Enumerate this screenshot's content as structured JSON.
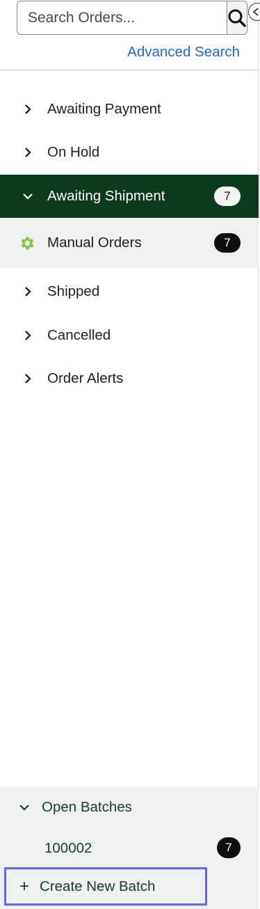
{
  "search": {
    "placeholder": "Search Orders...",
    "advanced_label": "Advanced Search"
  },
  "nav": {
    "items": [
      {
        "label": "Awaiting Payment"
      },
      {
        "label": "On Hold"
      },
      {
        "label": "Awaiting Shipment",
        "count": "7",
        "expanded": true
      },
      {
        "label": "Manual Orders",
        "count": "7"
      },
      {
        "label": "Shipped"
      },
      {
        "label": "Cancelled"
      },
      {
        "label": "Order Alerts"
      }
    ]
  },
  "batches": {
    "header_label": "Open Batches",
    "items": [
      {
        "id": "100002",
        "count": "7"
      }
    ],
    "create_label": "Create New Batch"
  },
  "colors": {
    "active_bg": "#0c3a1d",
    "link": "#2566c9",
    "gear": "#8bc34a",
    "highlight_border": "#6b63f0"
  },
  "icons": [
    "search-icon",
    "collapse-icon",
    "chevron-right-icon",
    "chevron-down-icon",
    "gear-icon",
    "plus-icon"
  ]
}
